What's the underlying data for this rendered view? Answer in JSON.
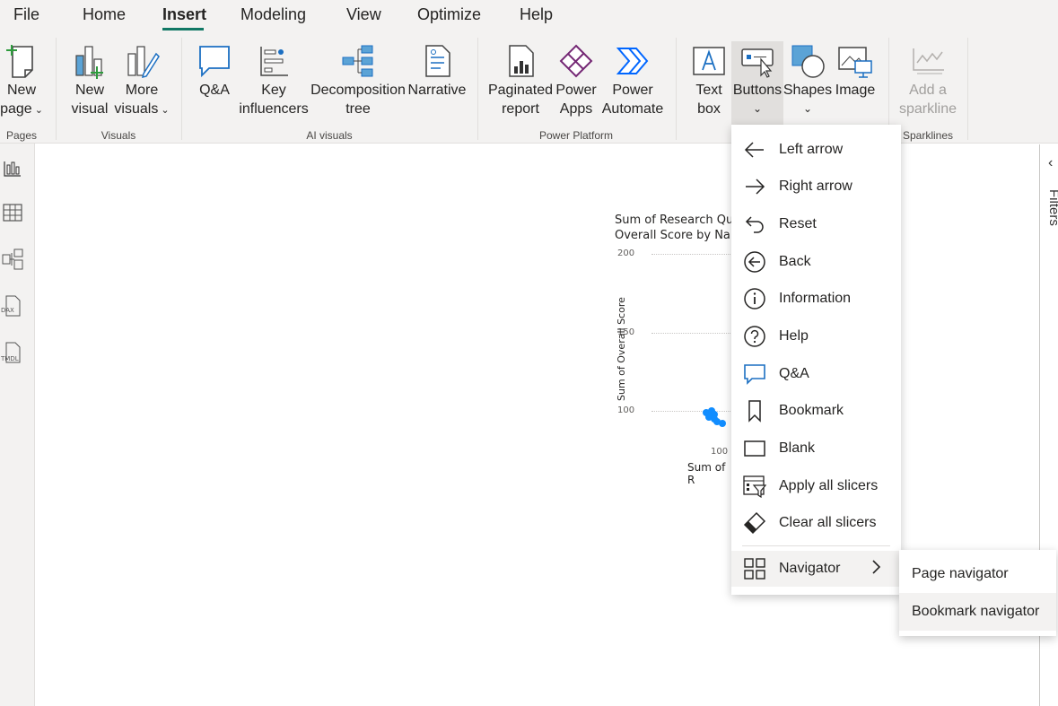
{
  "menu": {
    "tabs": [
      {
        "label": "File"
      },
      {
        "label": "Home"
      },
      {
        "label": "Insert"
      },
      {
        "label": "Modeling"
      },
      {
        "label": "View"
      },
      {
        "label": "Optimize"
      },
      {
        "label": "Help"
      }
    ],
    "active_tab": "Insert"
  },
  "ribbon": {
    "pages": {
      "new_page": [
        "New",
        "page"
      ],
      "group": "Pages"
    },
    "visuals": {
      "new_visual": [
        "New",
        "visual"
      ],
      "more_visuals": [
        "More",
        "visuals"
      ],
      "group": "Visuals"
    },
    "ai_visuals": {
      "qa": "Q&A",
      "key_influencers": [
        "Key",
        "influencers"
      ],
      "decomposition_tree": [
        "Decomposition",
        "tree"
      ],
      "narrative": "Narrative",
      "group": "AI visuals"
    },
    "power_platform": {
      "paginated_report": [
        "Paginated",
        "report"
      ],
      "power_apps": [
        "Power",
        "Apps"
      ],
      "power_automate": [
        "Power",
        "Automate"
      ],
      "group": "Power Platform"
    },
    "elements": {
      "text_box": [
        "Text",
        "box"
      ],
      "buttons": "Buttons",
      "shapes": "Shapes",
      "image": "Image"
    },
    "sparklines": {
      "add_sparkline": [
        "Add a",
        "sparkline"
      ],
      "group": "Sparklines"
    }
  },
  "chart_data": {
    "type": "scatter",
    "title": "Sum of Research Qu… Overall Score by Na…",
    "title_lines": [
      "Sum of Research Qu",
      "Overall Score by Na"
    ],
    "ylabel": "Sum of Overall Score",
    "xlabel": "Sum of R",
    "y_ticks": [
      "200",
      "150",
      "100"
    ],
    "x_ticks": [
      "100"
    ],
    "ylim": [
      100,
      200
    ],
    "series": [
      {
        "points": [
          [
            97,
            107
          ],
          [
            99,
            108
          ],
          [
            100,
            106
          ],
          [
            98,
            104
          ],
          [
            100,
            103
          ],
          [
            101,
            101
          ],
          [
            103,
            100
          ]
        ]
      }
    ],
    "colors": {
      "points": "#118dff"
    }
  },
  "buttons_menu": {
    "items": [
      {
        "label": "Left arrow",
        "icon": "left-arrow-icon"
      },
      {
        "label": "Right arrow",
        "icon": "right-arrow-icon"
      },
      {
        "label": "Reset",
        "icon": "reset-icon"
      },
      {
        "label": "Back",
        "icon": "back-icon"
      },
      {
        "label": "Information",
        "icon": "information-icon"
      },
      {
        "label": "Help",
        "icon": "help-icon"
      },
      {
        "label": "Q&A",
        "icon": "qa-icon"
      },
      {
        "label": "Bookmark",
        "icon": "bookmark-icon"
      },
      {
        "label": "Blank",
        "icon": "blank-icon"
      },
      {
        "label": "Apply all slicers",
        "icon": "apply-slicers-icon"
      },
      {
        "label": "Clear all slicers",
        "icon": "clear-slicers-icon"
      },
      {
        "label": "Navigator",
        "icon": "navigator-icon"
      }
    ]
  },
  "navigator_submenu": {
    "items": [
      {
        "label": "Page navigator"
      },
      {
        "label": "Bookmark navigator"
      }
    ]
  },
  "right_pane": {
    "label": "Filters"
  },
  "colors": {
    "accent": "#117865",
    "brand_blue": "#118dff",
    "powerapps_purple": "#742774",
    "automate_blue": "#0066ff"
  }
}
